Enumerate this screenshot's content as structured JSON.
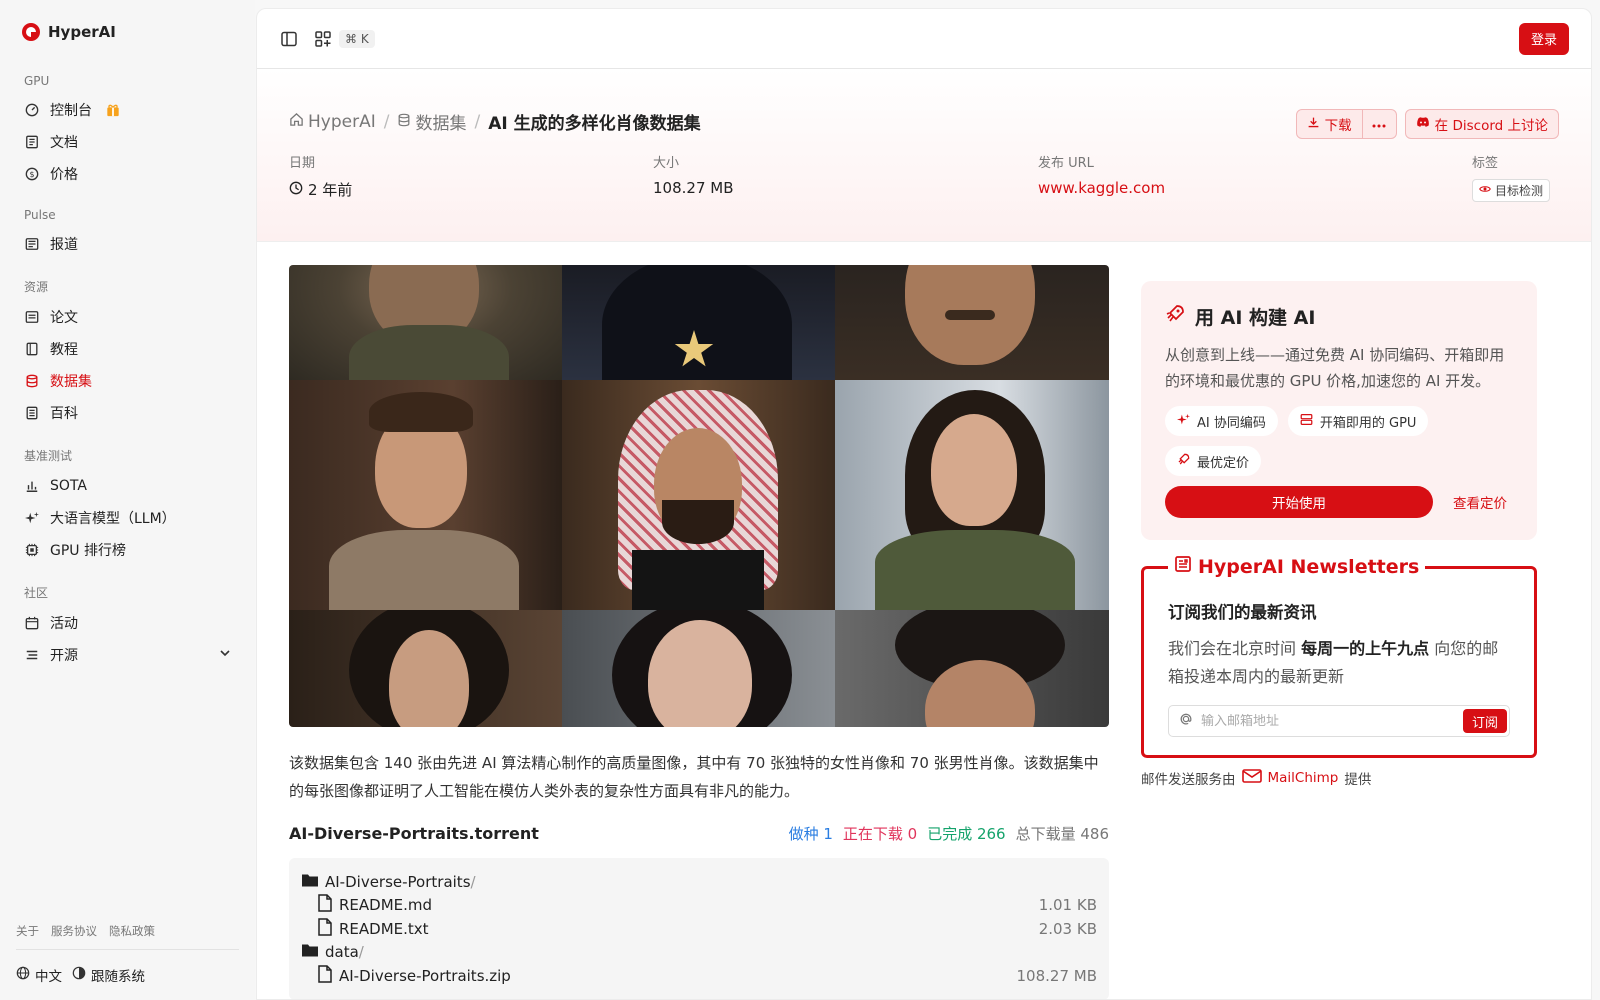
{
  "brand": {
    "name": "HyperAI"
  },
  "sidebar": {
    "sections": [
      {
        "label": "GPU",
        "items": [
          {
            "label": "控制台",
            "icon": "dashboard-icon"
          },
          {
            "label": "文档",
            "icon": "document-icon"
          },
          {
            "label": "价格",
            "icon": "dollar-icon"
          }
        ]
      },
      {
        "label": "Pulse",
        "items": [
          {
            "label": "报道",
            "icon": "news-icon"
          }
        ]
      },
      {
        "label": "资源",
        "items": [
          {
            "label": "论文",
            "icon": "paper-icon"
          },
          {
            "label": "教程",
            "icon": "book-icon"
          },
          {
            "label": "数据集",
            "icon": "database-icon",
            "active": true
          },
          {
            "label": "百科",
            "icon": "wiki-icon"
          }
        ]
      },
      {
        "label": "基准测试",
        "items": [
          {
            "label": "SOTA",
            "icon": "chart-icon"
          },
          {
            "label": "大语言模型（LLM）",
            "icon": "sparkle-icon"
          },
          {
            "label": "GPU 排行榜",
            "icon": "cpu-icon"
          }
        ]
      },
      {
        "label": "社区",
        "items": [
          {
            "label": "活动",
            "icon": "calendar-icon"
          },
          {
            "label": "开源",
            "icon": "menu-icon"
          }
        ]
      }
    ],
    "footer_links": [
      "关于",
      "服务协议",
      "隐私政策"
    ],
    "language": "中文",
    "theme": "跟随系统"
  },
  "topbar": {
    "shortcut": "⌘ K",
    "login_label": "登录"
  },
  "header": {
    "breadcrumb": {
      "home": "HyperAI",
      "section": "数据集",
      "current": "AI 生成的多样化肖像数据集"
    },
    "download_label": "下载",
    "discord_label": "在 Discord 上讨论",
    "meta": {
      "date_label": "日期",
      "date_value": "2 年前",
      "size_label": "大小",
      "size_value": "108.27 MB",
      "url_label": "发布 URL",
      "url_value": "www.kaggle.com",
      "tags_label": "标签",
      "tag_value": "目标检测"
    }
  },
  "dataset": {
    "description": "该数据集包含 140 张由先进 AI 算法精心制作的高质量图像，其中有 70 张独特的女性肖像和 70 张男性肖像。该数据集中的每张图像都证明了人工智能在模仿人类外表的复杂性方面具有非凡的能力。",
    "torrent_name": "AI-Diverse-Portraits.torrent",
    "stats": {
      "seeds": "做种 1",
      "downloading": "正在下载 0",
      "completed": "已完成 266",
      "total": "总下载量 486"
    },
    "files": [
      {
        "name": "AI-Diverse-Portraits",
        "suffix": "/",
        "type": "folder",
        "size": ""
      },
      {
        "name": "README.md",
        "suffix": "",
        "type": "file",
        "size": "1.01 KB"
      },
      {
        "name": "README.txt",
        "suffix": "",
        "type": "file",
        "size": "2.03 KB"
      },
      {
        "name": "data",
        "suffix": "/",
        "type": "folder",
        "size": ""
      },
      {
        "name": "AI-Diverse-Portraits.zip",
        "suffix": "",
        "type": "file",
        "size": "108.27 MB"
      }
    ]
  },
  "promo": {
    "title": "用 AI 构建 AI",
    "text": "从创意到上线——通过免费 AI 协同编码、开箱即用的环境和最优惠的 GPU 价格,加速您的 AI 开发。",
    "chips": [
      "AI 协同编码",
      "开箱即用的 GPU",
      "最优定价"
    ],
    "start_label": "开始使用",
    "pricing_label": "查看定价"
  },
  "newsletter": {
    "title": "HyperAI Newsletters",
    "heading": "订阅我们的最新资讯",
    "text_pre": "我们会在北京时间 ",
    "text_bold": "每周一的上午九点",
    "text_post": " 向您的邮箱投递本周内的最新更新",
    "placeholder": "输入邮箱地址",
    "subscribe_label": "订阅",
    "note_pre": "邮件发送服务由",
    "note_brand": "MailChimp",
    "note_post": "提供"
  }
}
